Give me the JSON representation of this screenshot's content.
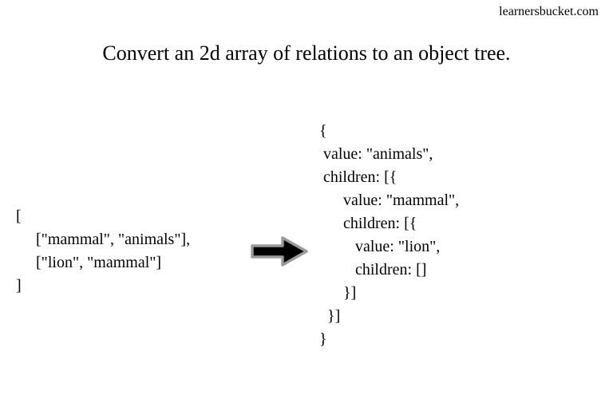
{
  "watermark": "learnersbucket.com",
  "title": "Convert an 2d array of relations to an object tree.",
  "input_code": "[\n     [\"mammal\", \"animals\"],\n     [\"lion\", \"mammal\"]\n]",
  "output_code": "{\n value: \"animals\",\n children: [{\n      value: \"mammal\",\n      children: [{\n         value: \"lion\",\n         children: []\n      }]\n  }]\n}"
}
